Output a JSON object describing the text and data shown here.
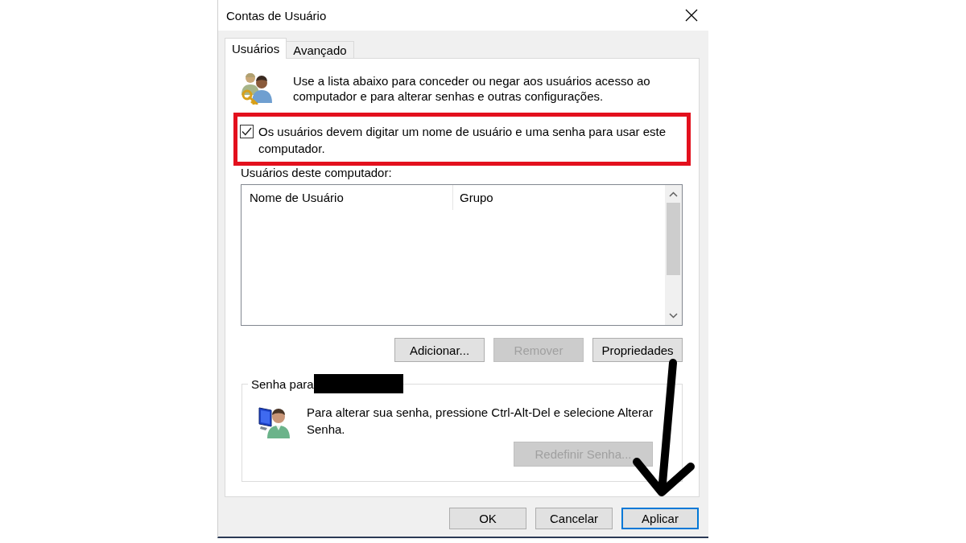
{
  "window": {
    "title": "Contas de Usuário"
  },
  "tabs": [
    {
      "label": "Usuários",
      "selected": true
    },
    {
      "label": "Avançado",
      "selected": false
    }
  ],
  "intro": {
    "text": "Use a lista abaixo para conceder ou negar aos usuários acesso ao computador e para alterar senhas e outras configurações."
  },
  "require_password": {
    "label": "Os usuários devem digitar um nome de usuário e uma senha para usar este computador.",
    "checked": true,
    "highlighted": true
  },
  "users": {
    "label": "Usuários deste computador:",
    "columns": [
      "Nome de Usuário",
      "Grupo"
    ]
  },
  "user_buttons": [
    {
      "label": "Adicionar...",
      "disabled": false
    },
    {
      "label": "Remover",
      "disabled": true
    },
    {
      "label": "Propriedades",
      "disabled": false
    }
  ],
  "password_group": {
    "label": "Senha para",
    "name_redacted": true,
    "text": "Para alterar sua senha, pressione Ctrl-Alt-Del e selecione Alterar Senha.",
    "button": {
      "label": "Redefinir Senha...",
      "disabled": true
    }
  },
  "dialog_buttons": [
    {
      "label": "OK",
      "default": false
    },
    {
      "label": "Cancelar",
      "default": false
    },
    {
      "label": "Aplicar",
      "default": true
    }
  ],
  "arrow_annotation": true
}
